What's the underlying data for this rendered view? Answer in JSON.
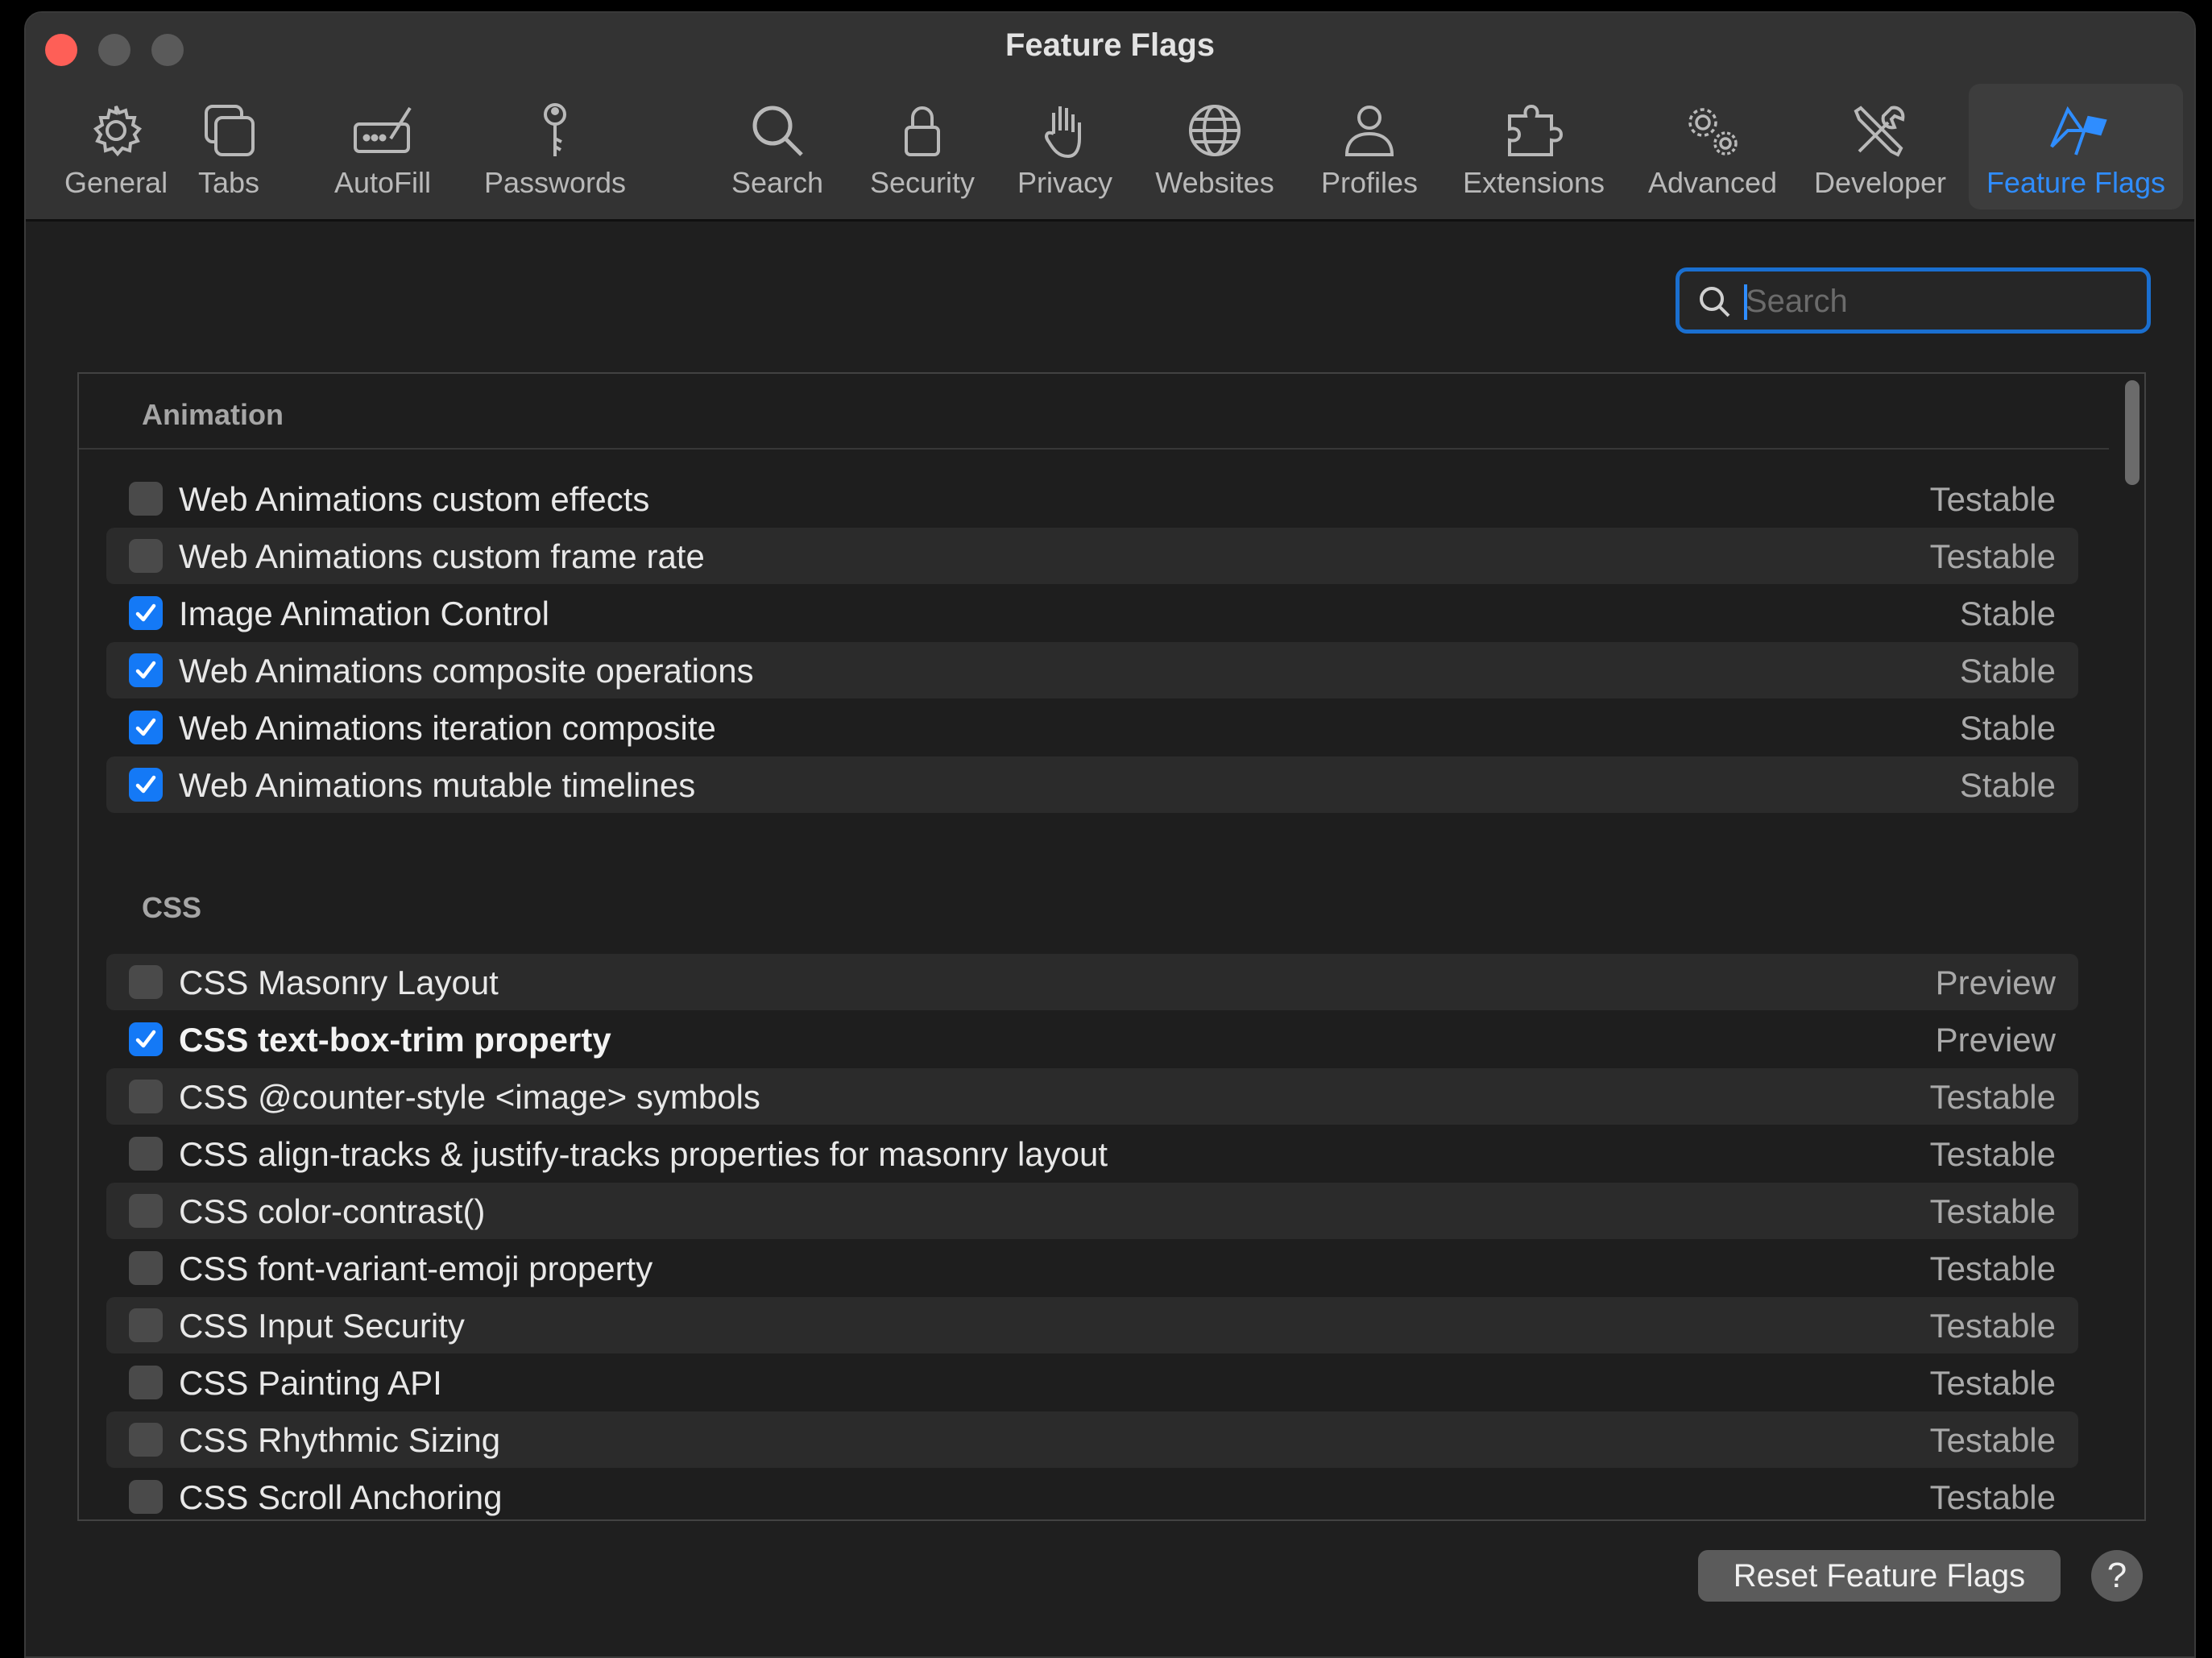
{
  "window": {
    "title": "Feature Flags"
  },
  "toolbar": {
    "items": [
      {
        "label": "General",
        "icon": "gear-icon"
      },
      {
        "label": "Tabs",
        "icon": "tabs-icon"
      },
      {
        "label": "AutoFill",
        "icon": "autofill-icon"
      },
      {
        "label": "Passwords",
        "icon": "key-icon"
      },
      {
        "label": "Search",
        "icon": "magnifier-icon"
      },
      {
        "label": "Security",
        "icon": "lock-icon"
      },
      {
        "label": "Privacy",
        "icon": "hand-icon"
      },
      {
        "label": "Websites",
        "icon": "globe-icon"
      },
      {
        "label": "Profiles",
        "icon": "person-icon"
      },
      {
        "label": "Extensions",
        "icon": "puzzle-icon"
      },
      {
        "label": "Advanced",
        "icon": "gears-icon"
      },
      {
        "label": "Developer",
        "icon": "tools-icon"
      },
      {
        "label": "Feature Flags",
        "icon": "flags-icon",
        "selected": true
      }
    ],
    "accent_color": "#2f8dff"
  },
  "search": {
    "placeholder": "Search",
    "value": ""
  },
  "sections": [
    {
      "title": "Animation",
      "flags": [
        {
          "label": "Web Animations custom effects",
          "status": "Testable",
          "checked": false
        },
        {
          "label": "Web Animations custom frame rate",
          "status": "Testable",
          "checked": false
        },
        {
          "label": "Image Animation Control",
          "status": "Stable",
          "checked": true
        },
        {
          "label": "Web Animations composite operations",
          "status": "Stable",
          "checked": true
        },
        {
          "label": "Web Animations iteration composite",
          "status": "Stable",
          "checked": true
        },
        {
          "label": "Web Animations mutable timelines",
          "status": "Stable",
          "checked": true
        }
      ]
    },
    {
      "title": "CSS",
      "flags": [
        {
          "label": "CSS Masonry Layout",
          "status": "Preview",
          "checked": false
        },
        {
          "label": "CSS text-box-trim property",
          "status": "Preview",
          "checked": true,
          "bold": true
        },
        {
          "label": "CSS @counter-style <image> symbols",
          "status": "Testable",
          "checked": false
        },
        {
          "label": "CSS align-tracks & justify-tracks properties for masonry layout",
          "status": "Testable",
          "checked": false
        },
        {
          "label": "CSS color-contrast()",
          "status": "Testable",
          "checked": false
        },
        {
          "label": "CSS font-variant-emoji property",
          "status": "Testable",
          "checked": false
        },
        {
          "label": "CSS Input Security",
          "status": "Testable",
          "checked": false
        },
        {
          "label": "CSS Painting API",
          "status": "Testable",
          "checked": false
        },
        {
          "label": "CSS Rhythmic Sizing",
          "status": "Testable",
          "checked": false
        },
        {
          "label": "CSS Scroll Anchoring",
          "status": "Testable",
          "checked": false
        }
      ]
    }
  ],
  "footer": {
    "reset_label": "Reset Feature Flags",
    "help_label": "?"
  },
  "colors": {
    "checkbox_on": "#1479f6",
    "checkbox_off": "#4a4a4a",
    "close_button": "#fe5f57"
  }
}
